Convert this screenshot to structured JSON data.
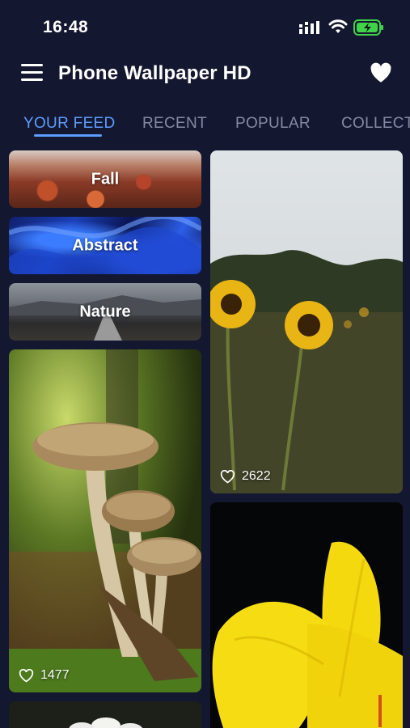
{
  "status": {
    "time": "16:48"
  },
  "app": {
    "title": "Phone Wallpaper HD"
  },
  "tabs": [
    {
      "label": "YOUR FEED",
      "active": true
    },
    {
      "label": "RECENT"
    },
    {
      "label": "POPULAR"
    },
    {
      "label": "COLLECTIONS"
    }
  ],
  "categories": [
    {
      "label": "Fall"
    },
    {
      "label": "Abstract"
    },
    {
      "label": "Nature"
    }
  ],
  "wallpapers": [
    {
      "subject": "mushrooms",
      "likes": "1477"
    },
    {
      "subject": "sunflowers",
      "likes": "2622"
    },
    {
      "subject": "yellow lily"
    },
    {
      "subject": "daisy"
    }
  ],
  "colors": {
    "background": "#141730",
    "accent": "#5d9dff",
    "tab_inactive": "#858aa3"
  }
}
